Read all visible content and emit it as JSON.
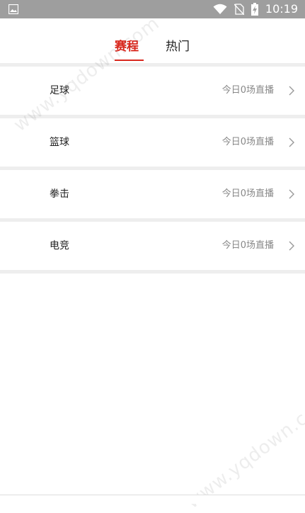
{
  "status_bar": {
    "time": "10:19",
    "icons": [
      "gallery-icon",
      "wifi-icon",
      "no-sim-icon",
      "battery-charging-icon"
    ]
  },
  "tabs": [
    {
      "label": "赛程",
      "active": true
    },
    {
      "label": "热门",
      "active": false
    }
  ],
  "list": {
    "items": [
      {
        "label": "足球",
        "status": "今日0场直播"
      },
      {
        "label": "篮球",
        "status": "今日0场直播"
      },
      {
        "label": "拳击",
        "status": "今日0场直播"
      },
      {
        "label": "电竞",
        "status": "今日0场直播"
      }
    ]
  },
  "watermark": "www.yqdown.com",
  "colors": {
    "accent": "#d9281e",
    "status_bar": "#9e9e9e",
    "divider": "#eeeeee"
  }
}
